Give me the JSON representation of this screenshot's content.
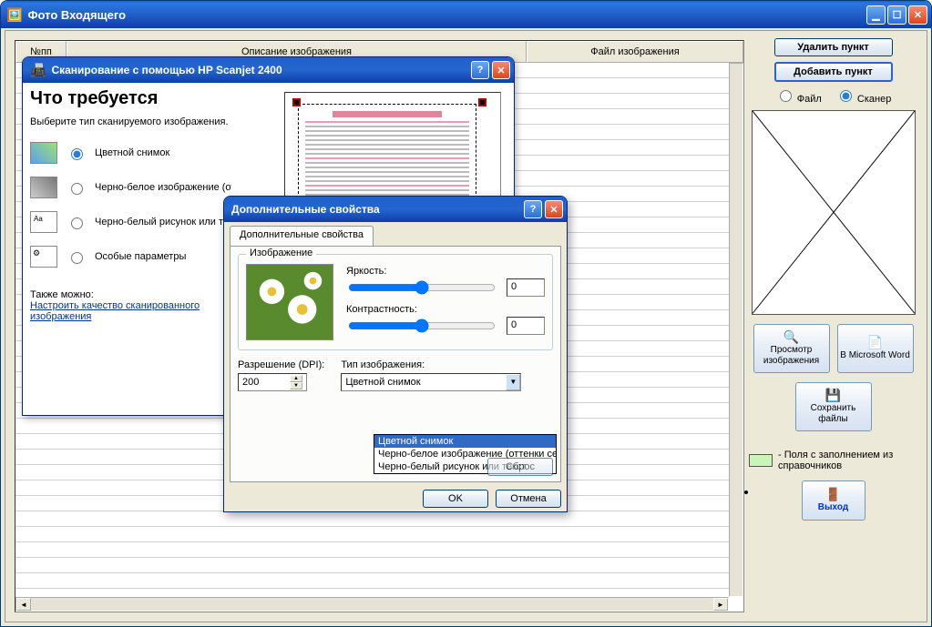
{
  "main": {
    "title": "Фото Входящего",
    "headers": {
      "num": "№пп",
      "desc": "Описание изображения",
      "file": "Файл изображения"
    }
  },
  "right": {
    "delete": "Удалить пункт",
    "add": "Добавить пункт",
    "radio_file": "Файл",
    "radio_scanner": "Сканер",
    "view": "Просмотр изображения",
    "word": "В Microsoft Word",
    "save": "Сохранить файлы",
    "legend": "- Поля с заполнением из справочников",
    "exit": "Выход"
  },
  "scan": {
    "title": "Сканирование с помощью HP Scanjet 2400",
    "heading": "Что требуется",
    "prompt": "Выберите тип сканируемого изображения.",
    "opts": {
      "color": "Цветной снимок",
      "gray": "Черно-белое изображение (оттенки серого)",
      "bw": "Черно-белый рисунок или текст",
      "custom": "Особые параметры"
    },
    "also": "Также можно:",
    "link": "Настроить качество сканированного изображения"
  },
  "adv": {
    "title": "Дополнительные свойства",
    "tab": "Дополнительные свойства",
    "group": "Изображение",
    "brightness": "Яркость:",
    "contrast": "Контрастность:",
    "b_val": "0",
    "c_val": "0",
    "dpi_label": "Разрешение (DPI):",
    "dpi": "200",
    "type_label": "Тип изображения:",
    "type_sel": "Цветной снимок",
    "reset": "Сброс",
    "ok": "OK",
    "cancel": "Отмена",
    "dd": {
      "o1": "Цветной снимок",
      "o2": "Черно-белое изображение (оттенки серого)",
      "o3": "Черно-белый рисунок или текст"
    }
  }
}
